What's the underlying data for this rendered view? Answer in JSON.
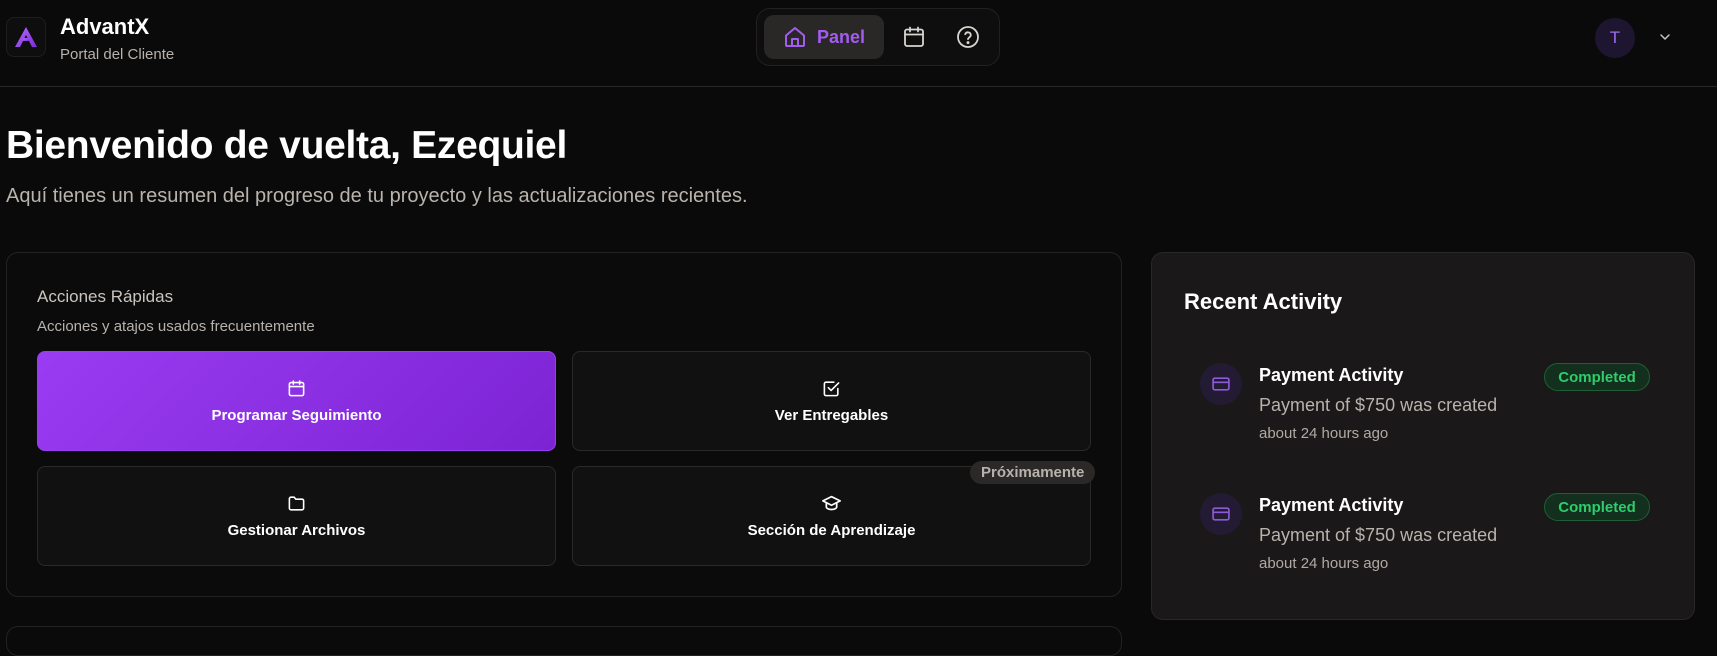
{
  "brand": {
    "name": "AdvantX",
    "subtitle": "Portal del Cliente"
  },
  "nav": {
    "active_label": "Panel",
    "items": [
      {
        "icon": "home-icon",
        "label": "Panel",
        "active": true
      },
      {
        "icon": "calendar-icon"
      },
      {
        "icon": "help-circle-icon"
      }
    ]
  },
  "user": {
    "avatar_initial": "T"
  },
  "welcome": {
    "title": "Bienvenido de vuelta, Ezequiel",
    "subtitle": "Aquí tienes un resumen del progreso de tu proyecto y las actualizaciones recientes."
  },
  "quick_actions": {
    "title": "Acciones Rápidas",
    "description": "Acciones y atajos usados frecuentemente",
    "buttons": [
      {
        "label": "Programar Seguimiento",
        "icon": "calendar-icon",
        "primary": true
      },
      {
        "label": "Ver Entregables",
        "icon": "check-square-icon"
      },
      {
        "label": "Gestionar Archivos",
        "icon": "folder-icon"
      },
      {
        "label": "Sección de Aprendizaje",
        "icon": "graduation-cap-icon",
        "badge": "Próximamente"
      }
    ]
  },
  "recent_activity": {
    "title": "Recent Activity",
    "items": [
      {
        "name": "Payment Activity",
        "text": "Payment of $750 was created",
        "time": "about 24 hours ago",
        "status": "Completed",
        "icon": "credit-card-icon"
      },
      {
        "name": "Payment Activity",
        "text": "Payment of $750 was created",
        "time": "about 24 hours ago",
        "status": "Completed",
        "icon": "credit-card-icon"
      }
    ]
  },
  "colors": {
    "accent": "#9a3cf2",
    "background": "#0b0a0a",
    "status_success": "#2ecc6a"
  }
}
